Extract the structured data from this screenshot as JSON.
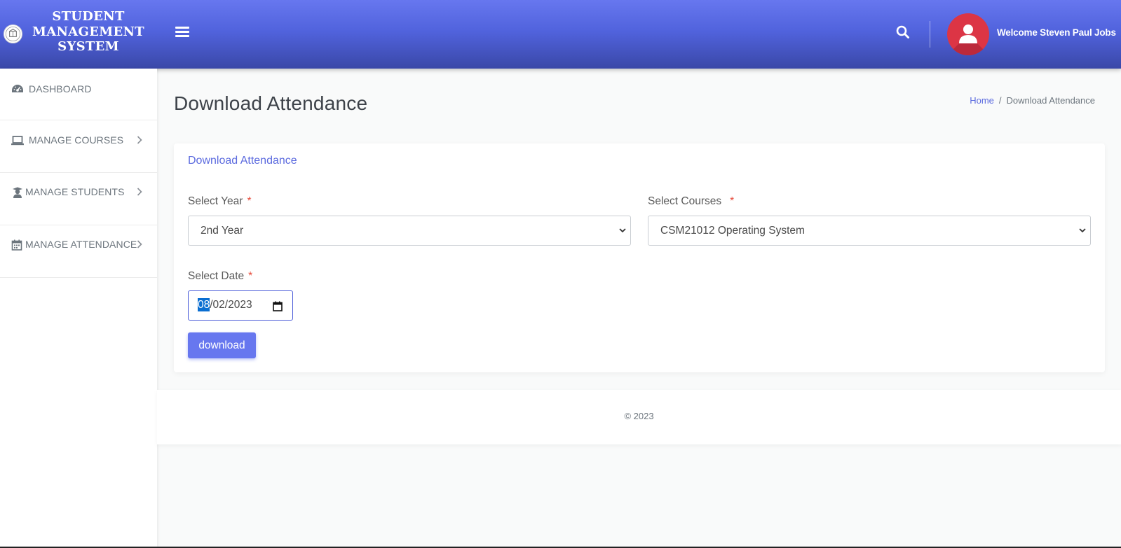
{
  "header": {
    "brand_title": "STUDENT MANAGEMENT SYSTEM",
    "welcome_text": "Welcome Steven Paul Jobs",
    "gradient_colors": [
      "#6777ef",
      "#3a48a8"
    ],
    "avatar_color": "#dc3545"
  },
  "sidebar": {
    "items": [
      {
        "label": "DASHBOARD",
        "icon": "dashboard-icon"
      },
      {
        "label": "MANAGE COURSES",
        "icon": "laptop-icon",
        "has_submenu": true
      },
      {
        "label": "MANAGE STUDENTS",
        "icon": "student-icon",
        "has_submenu": true
      },
      {
        "label": "MANAGE ATTENDANCE",
        "icon": "calendar-icon",
        "has_submenu": true
      }
    ]
  },
  "page": {
    "title": "Download Attendance",
    "breadcrumb": {
      "home": "Home",
      "current": "Download Attendance"
    }
  },
  "form": {
    "card_title": "Download Attendance",
    "year_label": "Select Year",
    "year_value": "2nd Year",
    "course_label": "Select Courses",
    "course_value": "CSM21012 Operating System",
    "date_label": "Select Date",
    "date_month": "08",
    "date_rest": "/02/2023",
    "required_marker": "*",
    "download_label": "download",
    "accent_color": "#6777ef"
  },
  "footer": {
    "text": "© 2023"
  }
}
